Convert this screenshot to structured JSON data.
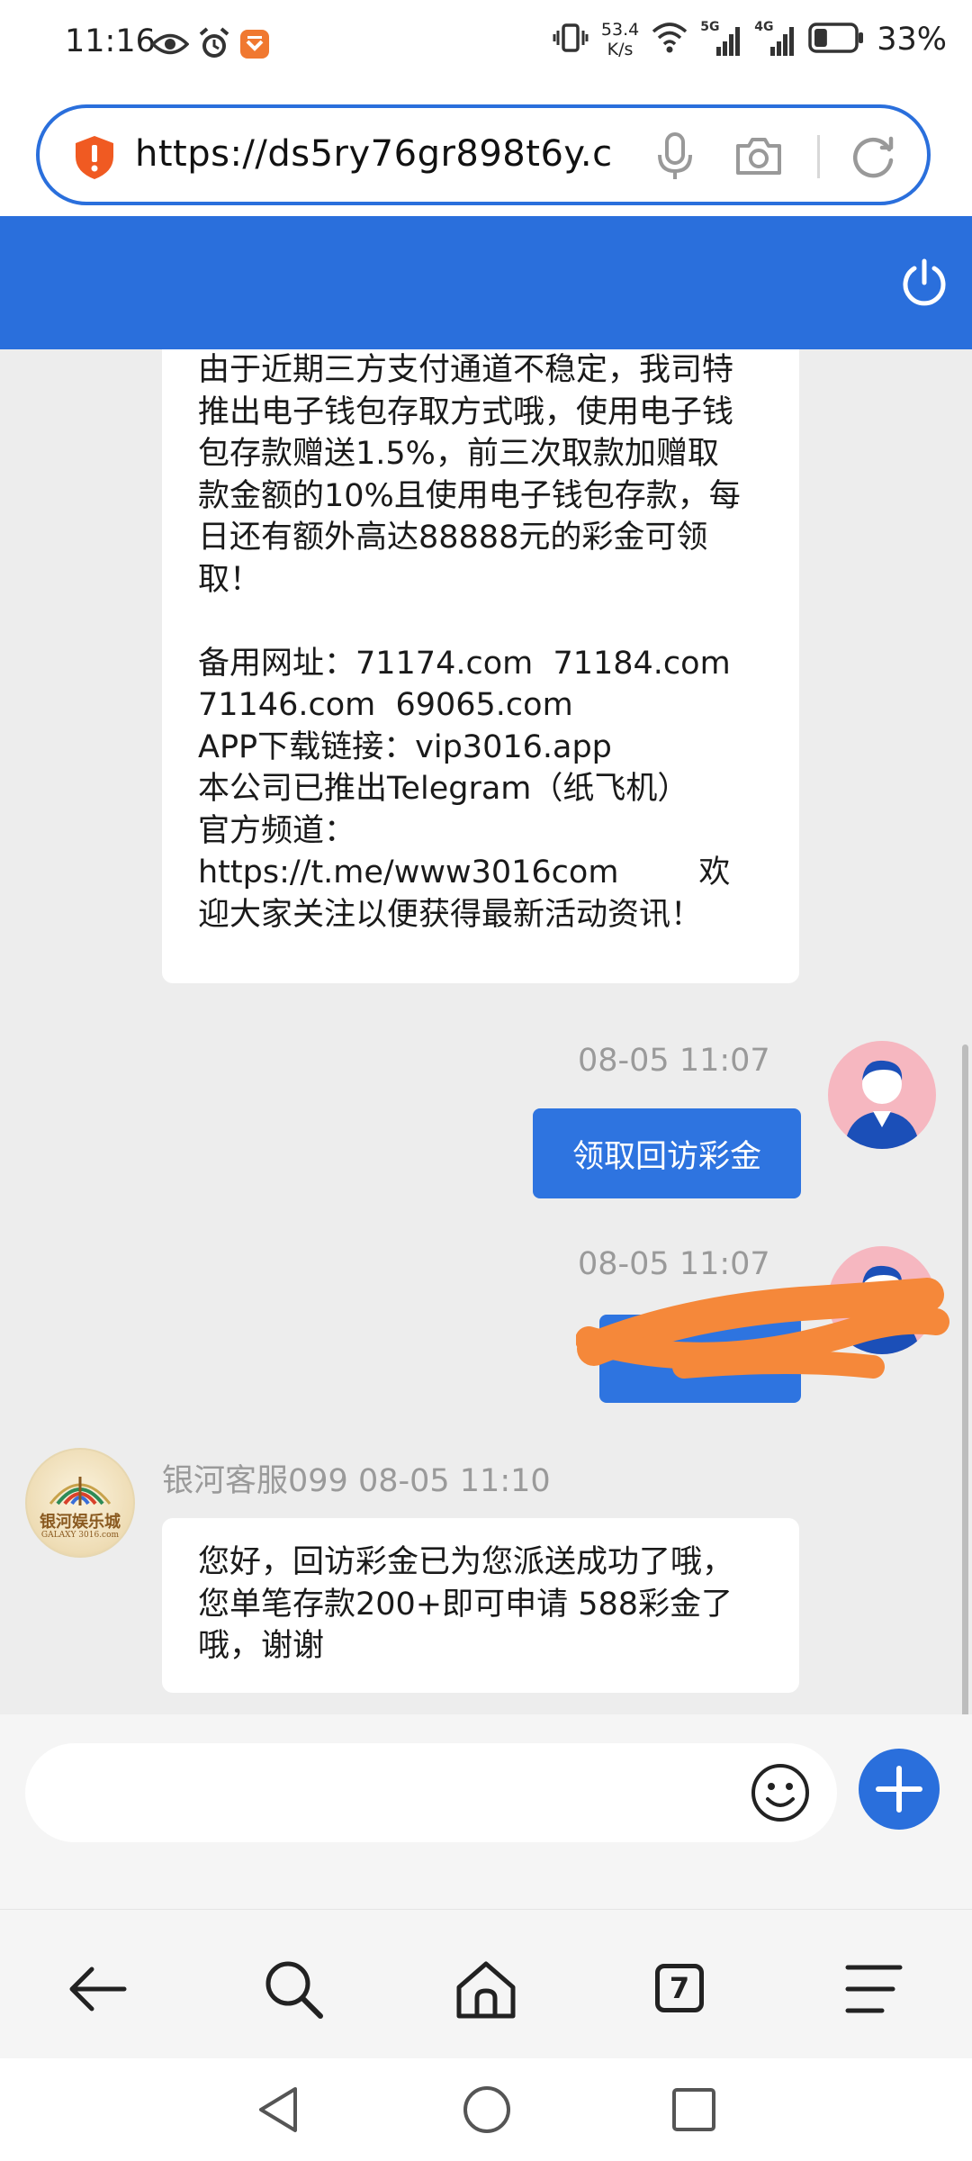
{
  "status_bar": {
    "time": "11:16",
    "net_speed_value": "53.4",
    "net_speed_unit": "K/s",
    "net_5g": "5G",
    "net_4g": "4G",
    "battery": "33%",
    "battery_level": 0.33,
    "icons": [
      "eye-icon",
      "alarm-icon",
      "app-badge-icon",
      "vibrate-icon",
      "wifi-icon",
      "signal-icon",
      "battery-icon"
    ]
  },
  "address_bar": {
    "url": "https://ds5ry76gr898t6y.c",
    "icons": [
      "security-shield-icon",
      "microphone-icon",
      "camera-icon",
      "refresh-icon"
    ]
  },
  "header": {
    "icons": [
      "power-icon"
    ]
  },
  "chat": {
    "first_message": {
      "lines": [
        "由于近期三方支付通道不稳定，我司特",
        "推出电子钱包存取方式哦，使用电子钱",
        "包存款赠送1.5%，前三次取款加赠取",
        "款金额的10%且使用电子钱包存款，每",
        "日还有额外高达88888元的彩金可领",
        "取！",
        "",
        "备用网址：71174.com  71184.com",
        "71146.com  69065.com",
        "APP下载链接：vip3016.app",
        "本公司已推出Telegram（纸飞机）",
        "官方频道：",
        "https://t.me/www3016com        欢",
        "迎大家关注以便获得最新活动资讯！"
      ]
    },
    "user_message_1": {
      "time": "08-05 11:07",
      "text": "领取回访彩金"
    },
    "user_message_2": {
      "time": "08-05 11:07",
      "text": ""
    },
    "agent_message": {
      "sender": "银河客服099",
      "time": "08-05 11:10",
      "logo_title": "银河娱乐城",
      "logo_sub": "GALAXY 3016.com",
      "lines": [
        "您好，回访彩金已为您派送成功了哦，",
        "您单笔存款200+即可申请 588彩金了",
        "哦，谢谢"
      ]
    }
  },
  "input_bar": {
    "placeholder": "",
    "icons": [
      "emoji-icon",
      "plus-icon"
    ]
  },
  "browser_nav": {
    "tab_count": "7",
    "icons": [
      "back-arrow-icon",
      "search-icon",
      "home-icon",
      "tabs-icon",
      "menu-icon"
    ]
  },
  "system_nav": {
    "icons": [
      "system-back-icon",
      "system-home-icon",
      "system-recents-icon"
    ]
  },
  "colors": {
    "accent": "#2a6fdc",
    "chat_bg": "#ededed",
    "redaction": "#f5883a"
  }
}
